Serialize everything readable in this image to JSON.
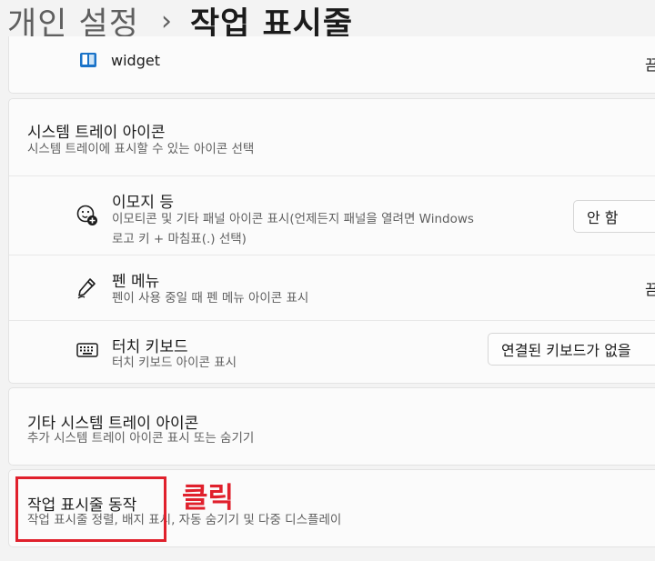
{
  "breadcrumb": {
    "parent": "개인 설정",
    "separator": "›",
    "current": "작업 표시줄"
  },
  "widget_row": {
    "label": "widget",
    "trailing": "끔"
  },
  "tray_section": {
    "title": "시스템 트레이 아이콘",
    "subtitle": "시스템 트레이에 표시할 수 있는 아이콘 선택"
  },
  "tray_items": [
    {
      "title": "이모지 등",
      "desc_line1": "이모티콘 및 기타 패널 아이콘 표시(언제든지 패널을 열려면 Windows",
      "desc_line2": "로고 키 + 마침표(.) 선택)",
      "control_value": "안 함"
    },
    {
      "title": "펜 메뉴",
      "desc": "펜이 사용 중일 때 펜 메뉴 아이콘 표시",
      "trailing": "끔"
    },
    {
      "title": "터치 키보드",
      "desc": "터치 키보드 아이콘 표시",
      "control_value": "연결된 키보드가 없을"
    }
  ],
  "other_tray": {
    "title": "기타 시스템 트레이 아이콘",
    "subtitle": "추가 시스템 트레이 아이콘 표시 또는 숨기기"
  },
  "behaviors": {
    "title": "작업 표시줄 동작",
    "subtitle": "작업 표시줄 정렬, 배지 표시, 자동 숨기기 및 다중 디스플레이"
  },
  "annotation": {
    "label": "클릭",
    "color": "#e0202c"
  },
  "icons": {
    "widget": "widget-icon",
    "emoji": "emoji-icon",
    "pen": "pen-icon",
    "keyboard": "keyboard-icon"
  }
}
